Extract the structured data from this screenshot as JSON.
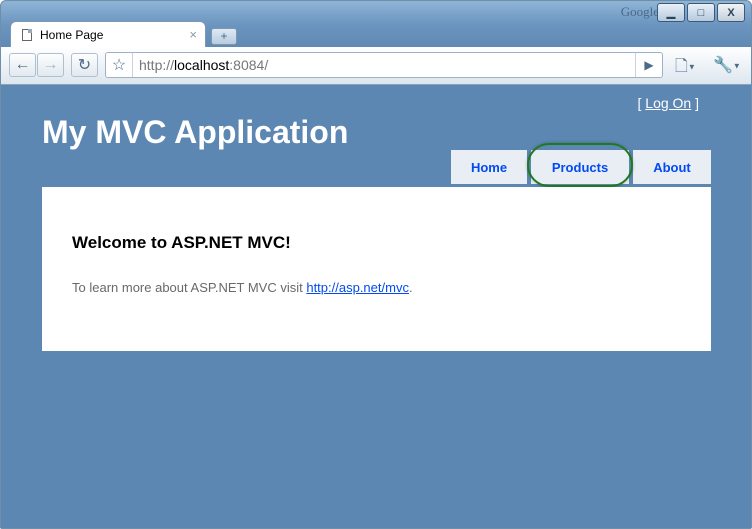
{
  "browser": {
    "brand": "Google",
    "tab_title": "Home Page",
    "tab_close": "×",
    "new_tab": "+",
    "url_prefix": "http://",
    "url_host": "localhost",
    "url_suffix": ":8084/",
    "window_controls": {
      "minimize": "▁",
      "maximize": "□",
      "close": "X"
    }
  },
  "page": {
    "login": {
      "open": "[",
      "link": "Log On",
      "close": "]"
    },
    "title": "My MVC Application",
    "menu": [
      {
        "label": "Home"
      },
      {
        "label": "Products"
      },
      {
        "label": "About"
      }
    ],
    "main": {
      "heading": "Welcome to ASP.NET MVC!",
      "text": "To learn more about ASP.NET MVC visit ",
      "link": "http://asp.net/mvc",
      "trailing": "."
    }
  },
  "annotation": {
    "highlighted_menu_item": "Products",
    "color": "#1f7a1f"
  },
  "icons": [
    "back-icon",
    "forward-icon",
    "reload-icon",
    "star-icon",
    "go-icon",
    "page-menu-icon",
    "wrench-icon",
    "page-icon"
  ]
}
